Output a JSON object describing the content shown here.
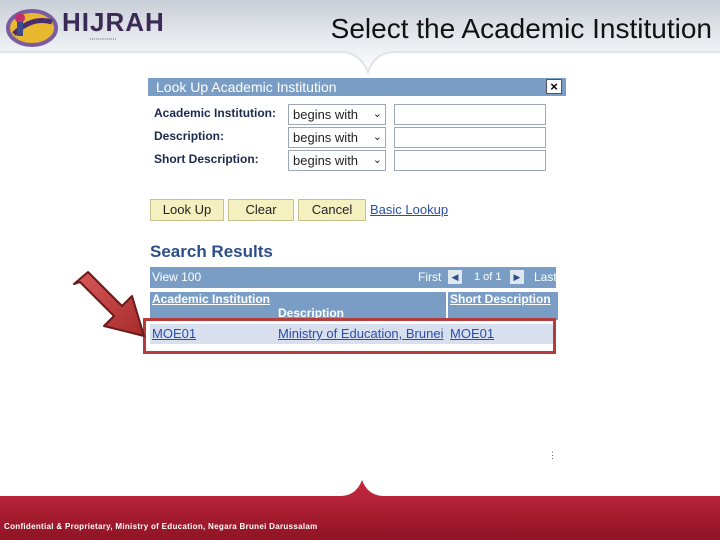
{
  "header": {
    "logo_text": "HIJRAH",
    "slide_title": "Select the Academic Institution"
  },
  "lookup": {
    "title": "Look Up Academic Institution",
    "close_glyph": "×",
    "fields": [
      {
        "label": "Academic Institution:",
        "operator": "begins with",
        "value": ""
      },
      {
        "label": "Description:",
        "operator": "begins with",
        "value": ""
      },
      {
        "label": "Short Description:",
        "operator": "begins with",
        "value": ""
      }
    ],
    "buttons": {
      "lookup": "Look Up",
      "clear": "Clear",
      "cancel": "Cancel"
    },
    "basic_lookup_link": "Basic Lookup"
  },
  "results": {
    "title": "Search Results",
    "view_link": "View 100",
    "first": "First",
    "page": "1 of 1",
    "last": "Last",
    "columns": [
      "Academic Institution",
      "Description",
      "Short Description"
    ],
    "rows": [
      {
        "institution": "MOE01",
        "description": "Ministry of Education, Brunei",
        "short": "MOE01"
      }
    ]
  },
  "footer": {
    "text": "Confidential & Proprietary, Ministry of Education, Negara Brunei Darussalam"
  },
  "colors": {
    "header_blue": "#7a9dc6",
    "footer_red": "#b8213a",
    "highlight_red": "#b63c3c",
    "button_yellow": "#f5f0c0"
  }
}
